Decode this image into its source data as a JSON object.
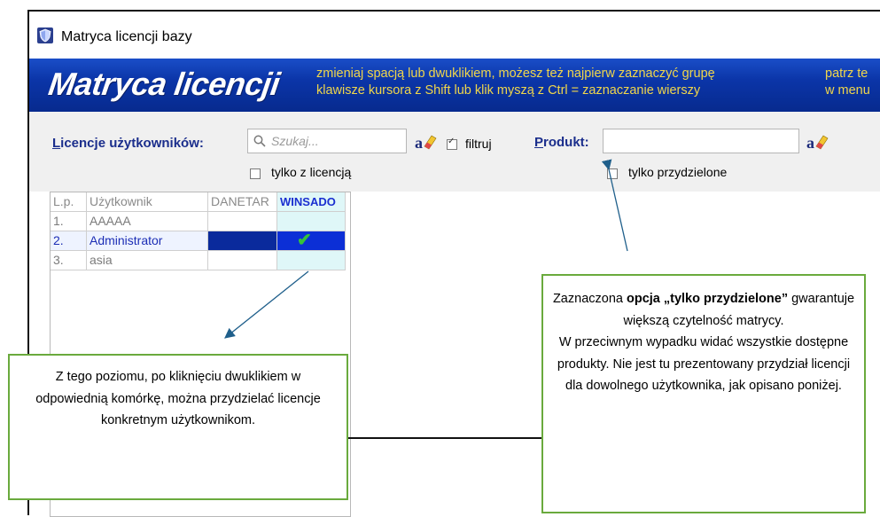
{
  "window": {
    "title": "Matryca licencji bazy",
    "icon": "shield-icon"
  },
  "banner": {
    "title": "Matryca licencji",
    "hint_line1": "zmieniaj spacją lub dwuklikiem, możesz też najpierw zaznaczyć grupę",
    "hint_line2": "klawisze kursora z Shift lub klik myszą z Ctrl = zaznaczanie wierszy",
    "hint_right1": "patrz te",
    "hint_right2": "w menu",
    "hint_color": "#f0d64b",
    "bg_color": "#0b35a8"
  },
  "toolbar": {
    "licenses_label_u": "L",
    "licenses_label_rest": "icencje użytkowników:",
    "search_placeholder": "Szukaj...",
    "filter_label": "filtruj",
    "filter_checked": true,
    "product_label_u": "P",
    "product_label_rest": "rodukt:",
    "product_value": "",
    "only_licensed_label": "tylko z licencją",
    "only_licensed_checked": false,
    "only_assigned_label": "tylko przydzielone",
    "only_assigned_checked": false
  },
  "grid": {
    "columns": [
      "L.p.",
      "Użytkownik",
      "DANETAR",
      "WINSADO"
    ],
    "rows": [
      {
        "lp": "1.",
        "user": "AAAAA",
        "danetar": "",
        "winsado": ""
      },
      {
        "lp": "2.",
        "user": "Administrator",
        "danetar": "",
        "winsado": "✔",
        "selected": true
      },
      {
        "lp": "3.",
        "user": "asia",
        "danetar": "",
        "winsado": ""
      }
    ]
  },
  "callouts": {
    "left": "Z tego poziomu, po kliknięciu dwuklikiem w odpowiednią komórkę, można przydzielać licencje konkretnym użytkownikom.",
    "right_pre": "Zaznaczona ",
    "right_bold": "opcja „tylko przydzielone”",
    "right_post1": " gwarantuje większą czytelność matrycy.",
    "right_post2": "W przeciwnym wypadku widać wszystkie dostępne produkty. Nie jest tu prezentowany przydział licencji dla dowolnego użytkownika, jak opisano poniżej.",
    "border_color": "#6aaa3d",
    "arrow_color": "#1f5f8b"
  }
}
